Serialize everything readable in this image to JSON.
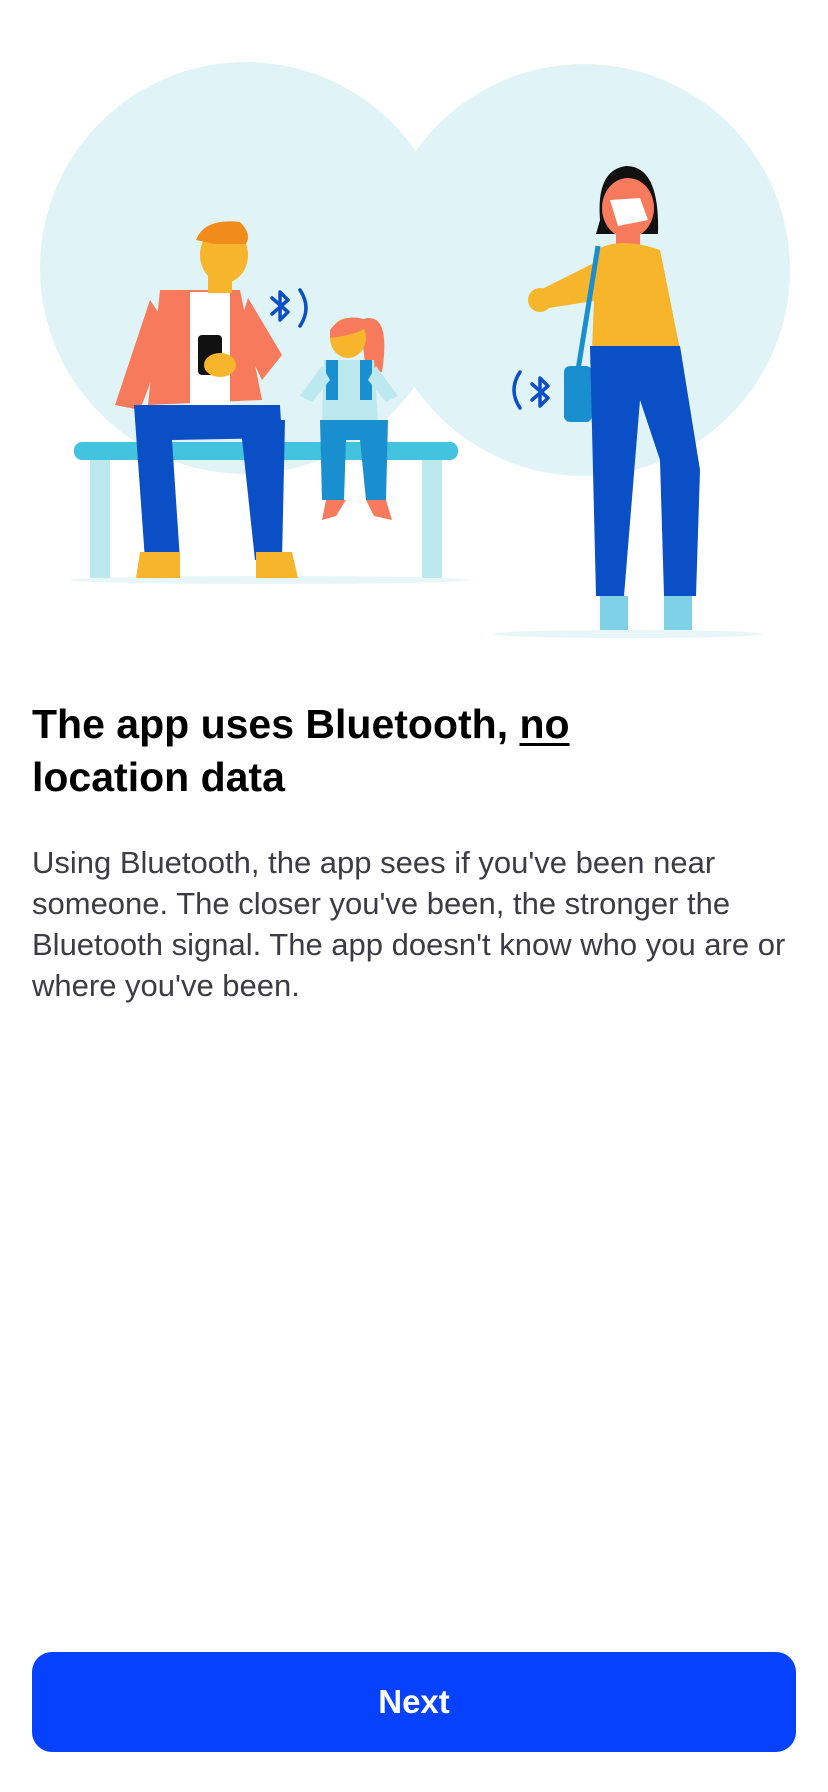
{
  "onboarding": {
    "illustration_name": "people-with-bluetooth-illustration",
    "title_main": "The app uses Bluetooth, ",
    "title_underlined": "no",
    "title_tail": " location data",
    "body": "Using Bluetooth, the app sees if you've been near someone. The closer you've been, the stronger the Bluetooth signal. The app doesn't know who you are or where you've been.",
    "next_label": "Next"
  },
  "colors": {
    "accent": "#0641ff",
    "background_blob": "#e0f4f7",
    "bench": "#44c3de",
    "pants": "#0b4fc6",
    "jacket": "#f77a5c",
    "skin": "#f6b52b"
  }
}
